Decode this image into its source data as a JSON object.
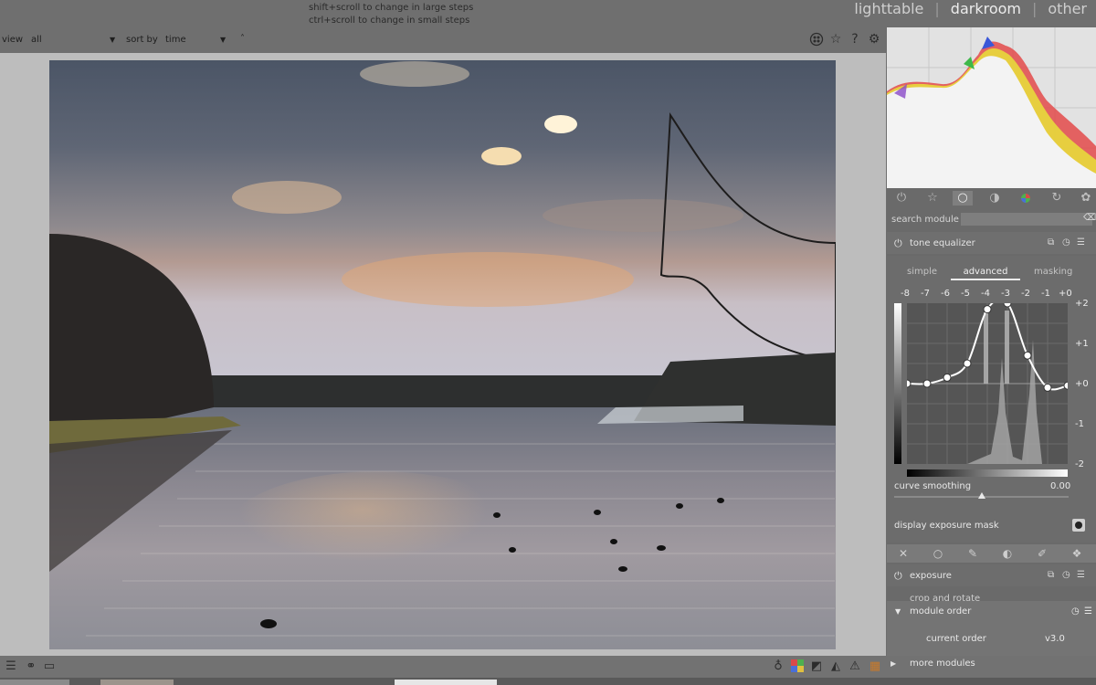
{
  "hints": [
    "shift+scroll to change in large steps",
    "ctrl+scroll to change in small steps"
  ],
  "views": {
    "lighttable": "lighttable",
    "darkroom": "darkroom",
    "other": "other",
    "separator": "|"
  },
  "filter": {
    "view_label": "view",
    "view_value": "all",
    "sort_label": "sort by",
    "sort_value": "time",
    "order_glyph": "˄"
  },
  "toolbar_icons": [
    "color-assessment-icon",
    "star-icon",
    "help-icon",
    "gear-icon"
  ],
  "module_groups": [
    "power-icon",
    "star-icon",
    "circle-icon",
    "half-circle-icon",
    "color-wheel-icon",
    "correction-icon",
    "effects-icon"
  ],
  "search": {
    "label": "search module",
    "placeholder": ""
  },
  "tone_equalizer": {
    "title": "tone equalizer",
    "tabs": [
      "simple",
      "advanced",
      "masking"
    ],
    "active_tab": "advanced",
    "ev_top": [
      "-8",
      "-7",
      "-6",
      "-5",
      "-4",
      "-3",
      "-2",
      "-1",
      "+0"
    ],
    "ev_right": [
      "+2",
      "+1",
      "+0",
      "-1",
      "-2"
    ],
    "curve_nodes_ev": [
      0,
      0,
      0.15,
      0.5,
      1.85,
      2.0,
      0.7,
      -0.1,
      -0.05
    ],
    "curve_smoothing_label": "curve smoothing",
    "curve_smoothing_value": "0.00",
    "mask_label": "display exposure mask"
  },
  "exposure": {
    "title": "exposure"
  },
  "partial_module": {
    "title": "crop and rotate"
  },
  "module_order": {
    "title": "module order",
    "current_label": "current order",
    "current_value": "v3.0"
  },
  "more_modules": "more modules",
  "colors": {
    "accent_curve": "#ffffff",
    "panel_bg": "#6a6a6a",
    "center_bg": "#bdbdbd"
  }
}
